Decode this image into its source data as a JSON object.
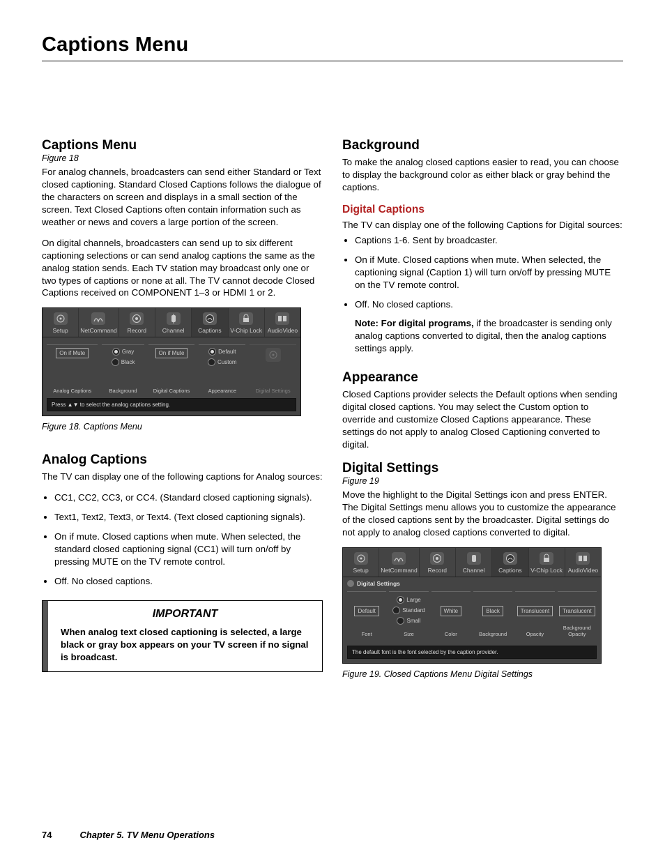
{
  "page_title": "Captions Menu",
  "page_number": "74",
  "chapter_line": "Chapter 5.  TV Menu Operations",
  "left": {
    "h_captions_menu": "Captions Menu",
    "figref_18": "Figure 18",
    "p1": "For analog channels, broadcasters can send either Standard or Text closed captioning.  Standard Closed Captions follows the dialogue of the characters on screen and displays in a small section of the screen.  Text Closed Captions often contain information such as weather or news and covers a large portion of the screen.",
    "p2": "On digital channels, broadcasters can send up to six different captioning selections or can send analog captions the same as the analog station sends.  Each TV station may broadcast only one or two types of captions or none at all.  The TV cannot decode Closed Captions received on COMPONENT 1–3 or HDMI 1 or 2.",
    "fig18_caption": "Figure 18.  Captions Menu",
    "h_analog": "Analog Captions",
    "p_analog_intro": "The TV can display one of the following captions for Analog sources:",
    "analog_bullets": [
      "CC1, CC2, CC3, or CC4. (Standard closed captioning signals).",
      "Text1, Text2, Text3, or Text4. (Text closed captioning signals).",
      "On if mute.  Closed captions when mute.  When selected, the standard closed captioning signal (CC1) will turn on/off by pressing MUTE on the TV remote control.",
      "Off.  No closed captions."
    ],
    "important_title": "IMPORTANT",
    "important_text": "When analog text closed captioning is selected, a large black or gray box appears on your TV screen if no signal is broadcast."
  },
  "right": {
    "h_background": "Background",
    "p_background": "To make the analog closed captions easier to read, you can choose to display the background color as either black or gray behind the captions.",
    "h_digital_captions": "Digital Captions",
    "p_digital_intro": "The TV can display one of the following Captions for Digital sources:",
    "dc_bullets": [
      "Captions 1-6.  Sent by broadcaster.",
      "On if Mute.  Closed captions when mute.  When selected, the captioning signal (Caption 1) will turn on/off by pressing MUTE on the TV remote control.",
      "Off. No closed captions."
    ],
    "note_bold": "Note:  For digital programs,",
    "note_rest": " if the broadcaster is sending only analog captions converted to digital, then the analog captions settings apply.",
    "h_appearance": "Appearance",
    "p_appearance": "Closed Captions provider selects the Default options when sending digital closed captions.  You may select the Custom option to override and customize Closed Captions appearance.  These settings do not apply to analog Closed Captioning converted to digital.",
    "h_digital_settings": "Digital Settings",
    "figref_19": "Figure 19",
    "p_digital_settings": "Move the highlight to the Digital Settings icon and press ENTER.  The Digital Settings menu allows you to customize the appearance of the closed captions sent by the broadcaster.  Digital settings do not apply to analog closed captions converted to digital.",
    "fig19_caption": "Figure 19.  Closed Captions Menu Digital Settings"
  },
  "tv_tabs": [
    "Setup",
    "NetCommand",
    "Record",
    "Channel",
    "Captions",
    "V-Chip Lock",
    "AudioVideo"
  ],
  "fig18": {
    "sec_labels": [
      "Analog Captions",
      "Background",
      "Digital Captions",
      "Appearance",
      "Digital Settings"
    ],
    "analog_btn": "On if Mute",
    "bg_opts": [
      "Gray",
      "Black"
    ],
    "digital_btn": "On if Mute",
    "appearance_opts": [
      "Default",
      "Custom"
    ],
    "help": "Press ▲▼ to select the analog captions setting."
  },
  "fig19": {
    "header": "Digital Settings",
    "row_labels": [
      "Font",
      "Size",
      "Color",
      "Background",
      "Opacity",
      "Background Opacity"
    ],
    "font_btn": "Default",
    "size_opts": [
      "Large",
      "Standard",
      "Small"
    ],
    "color_btn": "White",
    "bg_btn": "Black",
    "op_btn": "Translucent",
    "bgop_btn": "Translucent",
    "help": "The default font is the font selected by the caption provider."
  }
}
